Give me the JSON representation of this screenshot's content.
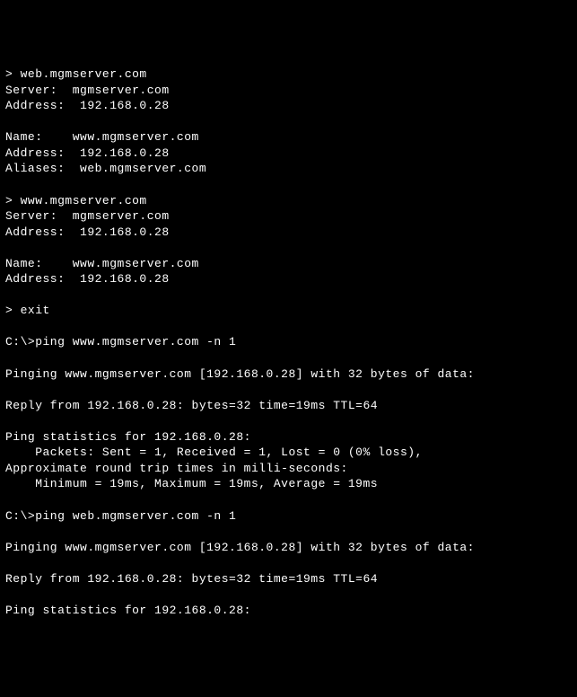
{
  "terminal": {
    "lines": [
      "> web.mgmserver.com",
      "Server:  mgmserver.com",
      "Address:  192.168.0.28",
      "",
      "Name:    www.mgmserver.com",
      "Address:  192.168.0.28",
      "Aliases:  web.mgmserver.com",
      "",
      "> www.mgmserver.com",
      "Server:  mgmserver.com",
      "Address:  192.168.0.28",
      "",
      "Name:    www.mgmserver.com",
      "Address:  192.168.0.28",
      "",
      "> exit",
      "",
      "C:\\>ping www.mgmserver.com -n 1",
      "",
      "Pinging www.mgmserver.com [192.168.0.28] with 32 bytes of data:",
      "",
      "Reply from 192.168.0.28: bytes=32 time=19ms TTL=64",
      "",
      "Ping statistics for 192.168.0.28:",
      "    Packets: Sent = 1, Received = 1, Lost = 0 (0% loss),",
      "Approximate round trip times in milli-seconds:",
      "    Minimum = 19ms, Maximum = 19ms, Average = 19ms",
      "",
      "C:\\>ping web.mgmserver.com -n 1",
      "",
      "Pinging www.mgmserver.com [192.168.0.28] with 32 bytes of data:",
      "",
      "Reply from 192.168.0.28: bytes=32 time=19ms TTL=64",
      "",
      "Ping statistics for 192.168.0.28:"
    ]
  }
}
